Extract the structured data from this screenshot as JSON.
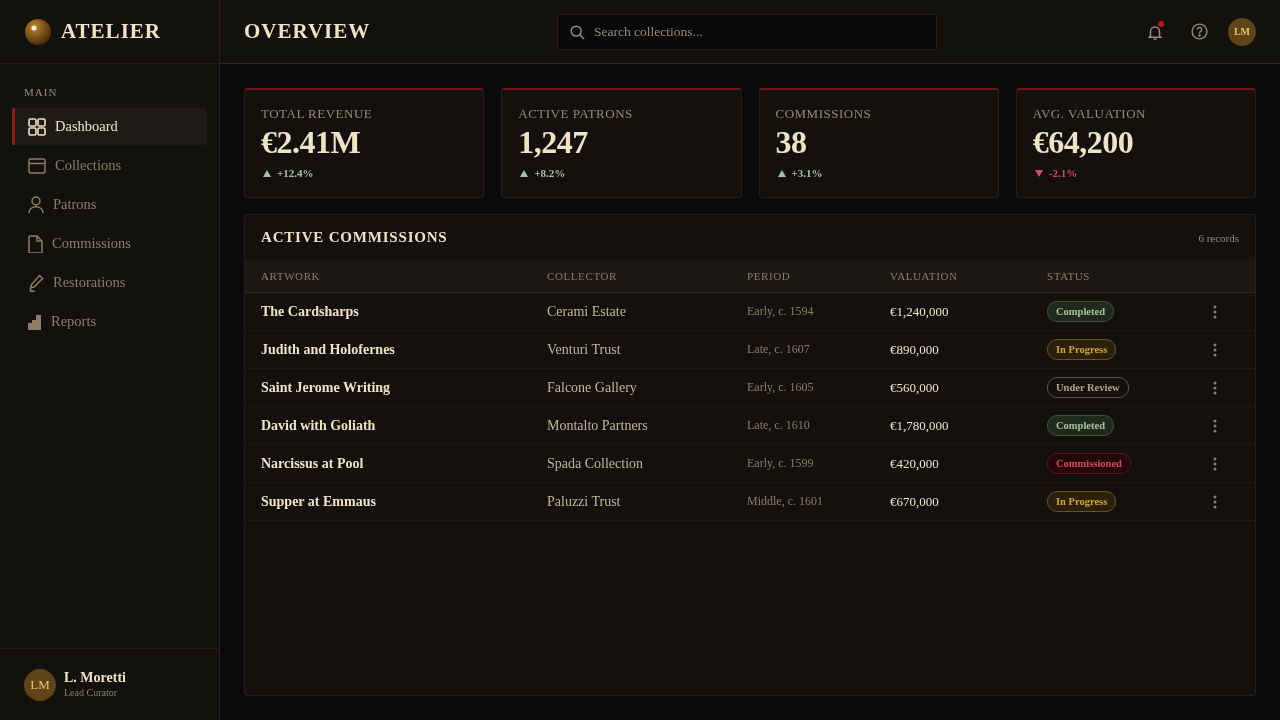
{
  "brand": {
    "name": "ATELIER"
  },
  "sidebar": {
    "section_label": "MAIN",
    "items": [
      {
        "label": "Dashboard",
        "selected": true
      },
      {
        "label": "Collections",
        "selected": false
      },
      {
        "label": "Patrons",
        "selected": false
      },
      {
        "label": "Commissions",
        "selected": false
      },
      {
        "label": "Restorations",
        "selected": false
      },
      {
        "label": "Reports",
        "selected": false
      }
    ],
    "user": {
      "initials": "LM",
      "name": "L. Moretti",
      "role": "Lead Curator"
    }
  },
  "header": {
    "title": "OVERVIEW",
    "search": {
      "placeholder": "Search collections..."
    },
    "notifications": {
      "unread": true
    },
    "avatar": {
      "initials": "LM"
    }
  },
  "stats": [
    {
      "label": "TOTAL REVENUE",
      "value": "€2.41M",
      "change": "+12.4%",
      "kind": "up"
    },
    {
      "label": "ACTIVE PATRONS",
      "value": "1,247",
      "change": "+8.2%",
      "kind": "up"
    },
    {
      "label": "COMMISSIONS",
      "value": "38",
      "change": "+3.1%",
      "kind": "up"
    },
    {
      "label": "AVG. VALUATION",
      "value": "€64,200",
      "change": "-2.1%",
      "kind": "down"
    }
  ],
  "table": {
    "title": "ACTIVE COMMISSIONS",
    "count": "6 records",
    "columns": [
      "ARTWORK",
      "COLLECTOR",
      "PERIOD",
      "VALUATION",
      "STATUS"
    ],
    "rows": [
      {
        "artwork": "The Cardsharps",
        "collector": "Cerami Estate",
        "period": "Early, c. 1594",
        "valuation": "€1,240,000",
        "status": {
          "label": "Completed",
          "kind": "completed"
        }
      },
      {
        "artwork": "Judith and Holofernes",
        "collector": "Venturi Trust",
        "period": "Late, c. 1607",
        "valuation": "€890,000",
        "status": {
          "label": "In Progress",
          "kind": "in_progress"
        }
      },
      {
        "artwork": "Saint Jerome Writing",
        "collector": "Falcone Gallery",
        "period": "Early, c. 1605",
        "valuation": "€560,000",
        "status": {
          "label": "Under Review",
          "kind": "review"
        }
      },
      {
        "artwork": "David with Goliath",
        "collector": "Montalto Partners",
        "period": "Late, c. 1610",
        "valuation": "€1,780,000",
        "status": {
          "label": "Completed",
          "kind": "completed"
        }
      },
      {
        "artwork": "Narcissus at Pool",
        "collector": "Spada Collection",
        "period": "Early, c. 1599",
        "valuation": "€420,000",
        "status": {
          "label": "Commissioned",
          "kind": "commissioned"
        }
      },
      {
        "artwork": "Supper at Emmaus",
        "collector": "Paluzzi Trust",
        "period": "Middle, c. 1601",
        "valuation": "€670,000",
        "status": {
          "label": "In Progress",
          "kind": "in_progress"
        }
      }
    ]
  }
}
